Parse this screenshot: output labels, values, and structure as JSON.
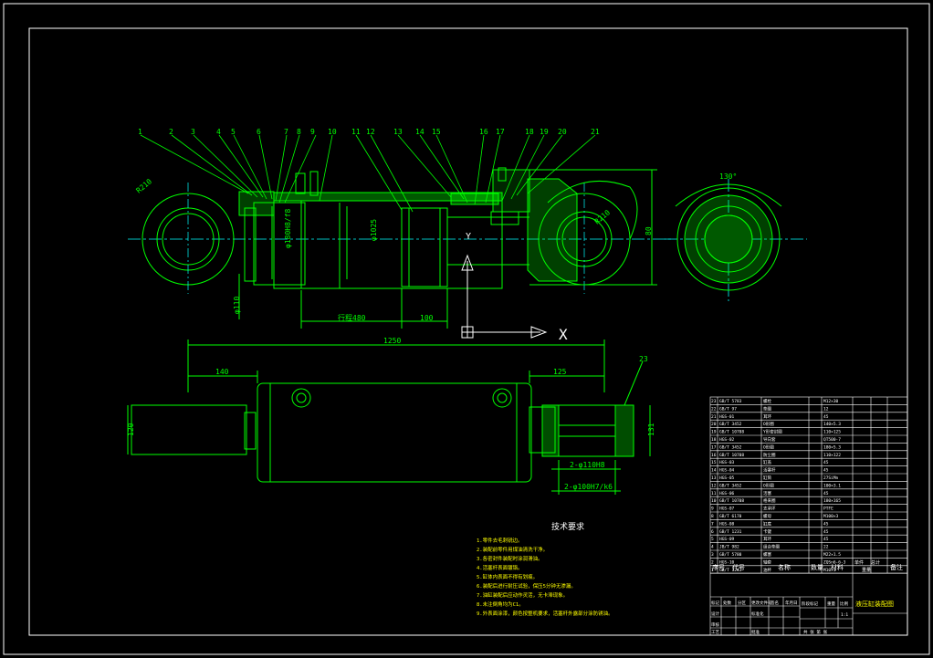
{
  "drawing": {
    "balloons": [
      "1",
      "2",
      "3",
      "4",
      "5",
      "6",
      "7",
      "8",
      "9",
      "10",
      "11",
      "12",
      "13",
      "14",
      "15",
      "16",
      "17",
      "18",
      "19",
      "20",
      "21"
    ],
    "balloon23": "23",
    "dims": {
      "r_left": "R210",
      "r_right": "R210",
      "phi_rod": "φ110",
      "phi_bore": "φ180H8/f8",
      "phi_ext": "φ1025",
      "stroke": "行程480",
      "d100": "100",
      "overall": "1250",
      "d140": "140",
      "d125": "125",
      "d120": "120",
      "d131": "131",
      "angle": "130°",
      "bottom1": "2-φ110H8",
      "bottom2": "2-φ100H7/k6",
      "d80": "80"
    },
    "ucs": {
      "x": "X",
      "y": "Y"
    },
    "notes_title": "技术要求",
    "notes": [
      "1.零件去毛刺锐边。",
      "2.装配前零件用煤油清洗干净。",
      "3.各密封件装配时涂润滑油。",
      "4.活塞杆表面镀铬。",
      "5.缸体内表面不得有划痕。",
      "6.装配后进行耐压试验，保压5分钟无渗漏。",
      "7.油缸装配后应动作灵活，无卡滞现象。",
      "8.未注倒角均为C1。",
      "9.外表面涂漆，颜色按整机要求，活塞杆外露部分涂防锈油。"
    ]
  },
  "parts_table": {
    "rows": [
      [
        "23",
        "GB/T 5783",
        "螺栓",
        "M12×30"
      ],
      [
        "22",
        "GB/T 97",
        "垫圈",
        "12"
      ],
      [
        "21",
        "HGS-01",
        "耳环",
        "45"
      ],
      [
        "20",
        "GB/T 3452",
        "O形圈",
        "140×5.3"
      ],
      [
        "19",
        "GB/T 10708",
        "Y形密封圈",
        "110×125"
      ],
      [
        "18",
        "HGS-02",
        "导向套",
        "QT500-7"
      ],
      [
        "17",
        "GB/T 3452",
        "O形圈",
        "180×5.3"
      ],
      [
        "16",
        "GB/T 10708",
        "防尘圈",
        "110×122"
      ],
      [
        "15",
        "HGS-03",
        "缸盖",
        "45"
      ],
      [
        "14",
        "HGS-04",
        "活塞杆",
        "45"
      ],
      [
        "13",
        "HGS-05",
        "缸筒",
        "27SiMn"
      ],
      [
        "12",
        "GB/T 3452",
        "O形圈",
        "100×3.1"
      ],
      [
        "11",
        "HGS-06",
        "活塞",
        "45"
      ],
      [
        "10",
        "GB/T 10708",
        "格来圈",
        "180×165"
      ],
      [
        "9",
        "HGS-07",
        "支承环",
        "PTFE"
      ],
      [
        "8",
        "GB/T 6170",
        "螺母",
        "M100×3"
      ],
      [
        "7",
        "HGS-08",
        "缸底",
        "45"
      ],
      [
        "6",
        "GB/T 1231",
        "卡键",
        "45"
      ],
      [
        "5",
        "HGS-09",
        "耳环",
        "45"
      ],
      [
        "4",
        "JB/T 982",
        "组合垫圈",
        "22"
      ],
      [
        "3",
        "GB/T 5780",
        "螺塞",
        "M22×1.5"
      ],
      [
        "2",
        "HGS-10",
        "轴套",
        "ZQSn6-6-3"
      ],
      [
        "1",
        "GB/T 1243",
        "油杯",
        "M10×1"
      ]
    ],
    "header": {
      "seq": "序号",
      "code": "代号",
      "name": "名称",
      "qty": "数量",
      "material": "材料",
      "unit_w": "单件",
      "total_w": "总计",
      "weight": "重量",
      "remark": "备注"
    },
    "title": "液压缸装配图",
    "labels": {
      "mark": "标记",
      "count": "处数",
      "zone": "分区",
      "change_no": "更改文件号",
      "sign": "签名",
      "date": "年月日",
      "design": "设计",
      "std": "标准化",
      "review": "审核",
      "process": "工艺",
      "approve": "批准",
      "stage": "阶段标记",
      "weight": "重量",
      "scale": "比例",
      "scale_val": "1:1",
      "sheet": "共 张 第 张"
    }
  }
}
